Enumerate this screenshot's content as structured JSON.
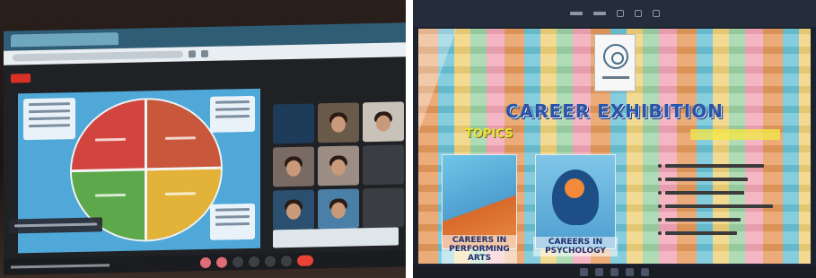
{
  "left_photo": {
    "slide_quadrants": [
      "red",
      "orange-red",
      "green",
      "yellow"
    ],
    "participant_tile_colors": [
      "#1f3b5a",
      "#6a5a4a",
      "#c9c2b8",
      "#7a6a64",
      "#9c8e84",
      "#3a3d42",
      "#2b4f6e",
      "#4a7fa8",
      "#3a3d42"
    ],
    "toolbar_button_count": 7
  },
  "right_photo": {
    "poster": {
      "title": "CAREER EXHIBITION",
      "topics_label": "TOPICS",
      "panels": [
        {
          "caption": "CAREERS IN PERFORMING ARTS"
        },
        {
          "caption": "CAREERS IN PSYCHOLOGY"
        }
      ],
      "presenter_count": 6
    }
  },
  "colors": {
    "slide_background": "#4fa8d8",
    "title_blue": "#2b54a8",
    "topics_yellow": "#e9e23a"
  }
}
